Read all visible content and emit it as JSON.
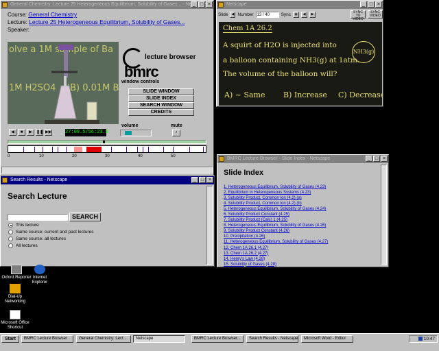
{
  "lecture_window": {
    "title": "General Chemistry: Lecture 25 Heterogeneous Equilibrium, Solubility of Gases... - Netscape",
    "course_label": "Course:",
    "course": "General Chemistry",
    "lecture_label": "Lecture:",
    "lecture": "Lecture 25 Heterogeneous Equilibrium, Solubility of Gases...",
    "speaker_label": "Speaker:",
    "speaker": "",
    "chalk_lines": [
      "olve a 1M sample of Ba",
      "1M H2SO4",
      "(B) 0.01M Ba"
    ],
    "brand_top": "lecture browser",
    "brand": "bmrc",
    "window_controls_label": "window controls",
    "buttons": [
      "SLIDE WINDOW",
      "SLIDE INDEX",
      "SEARCH WINDOW",
      "CREDITS"
    ],
    "volume_label": "volume",
    "mute_label": "mute",
    "timecode": "27:09.5/56:23.8",
    "scale": [
      "0",
      "10",
      "20",
      "30",
      "40",
      "50"
    ]
  },
  "slide_window": {
    "title": "Netscape",
    "toolbar": {
      "slide_label": "Slide",
      "number_label": "Number",
      "number_value": "13 / 40",
      "sync_label": "Sync",
      "btn1": "SYNC TO VIDEO",
      "btn2": "SYNC VIDEO"
    },
    "slide_lines": [
      "Chem 1A 26.2",
      "A squirt of H2O is injected into",
      "a balloon containing NH3(g) at 1atm.",
      "The volume of the balloon will?"
    ],
    "balloon_label": "NH3(g)",
    "answers": [
      "A) ~ Same",
      "B) Increase",
      "C) Decrease"
    ]
  },
  "search_window": {
    "title": "Search Results - Netscape",
    "heading": "Search Lecture",
    "input_value": "",
    "button": "SEARCH",
    "options": [
      "This lecture",
      "Same course: current and past lectures",
      "Same course: all lectures",
      "All lectures"
    ]
  },
  "index_window": {
    "title": "BMRC Lecture Browser - Slide Index - Netscape",
    "heading": "Slide Index",
    "items": [
      "1. Heterogeneous Equilibrium, Solubility of Gases (4.23)",
      "2. Equilibrium in Heterogeneous Systems (4.23)",
      "3. Solubility Product, Common Ion (4.2) (a)",
      "4. Solubility Product, Common Ion (4.2) (b)",
      "5. Heterogeneous Equilibrium, Solubility of Gases (4.24)",
      "6. Solubility Product Constant (4.25)",
      "7. Solubility Product (Calc) 1 (4.25)",
      "8. Heterogeneous Equilibrium, Solubility of Gases (4.26)",
      "9. Solubility Product Constant (4.26)",
      "10. Precipitation (4.26)",
      "11. Heterogeneous Equilibrium, Solubility of Gases (4.27)",
      "12. Chem 1A 26.1 (4.27)",
      "13. Chem 1A 26.2 (4.27)",
      "14. Henry's Law (4.28)",
      "15. Solubility of Gases (4.28)"
    ]
  },
  "desktop_icons": [
    {
      "label": "Oxford Reporter",
      "icon": "computer-icon"
    },
    {
      "label": "Internet Explorer",
      "icon": "globe-icon"
    },
    {
      "label": "Dial-Up Networking",
      "icon": "network-icon"
    },
    {
      "label": "Microsoft Office Shortcut",
      "icon": "office-icon"
    }
  ],
  "taskbar": {
    "start": "Start",
    "tasks": [
      "BMRC Lecture Browser",
      "General Chemistry: Lect...",
      "Netscape",
      "BMRC Lecture Browser...",
      "Search Results - Netscape",
      "Microsoft Word - Editor"
    ],
    "clock": "10:47"
  },
  "colors": {
    "titlebar_active": "#000080",
    "chalk": "#e8e070",
    "link": "#0000cc"
  }
}
